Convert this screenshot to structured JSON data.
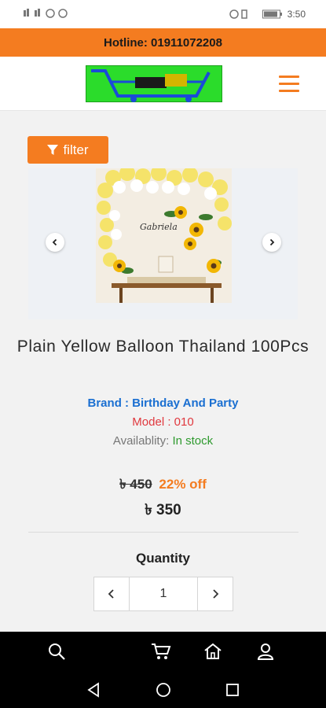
{
  "status_bar": {
    "time": "3:50",
    "battery": "88"
  },
  "hotline": "Hotline: 01911072208",
  "logo_icon": "shopping-cart-logo",
  "filter": {
    "label": "filter",
    "icon": "funnel-icon"
  },
  "carousel": {
    "prev_icon": "chevron-left-icon",
    "next_icon": "chevron-right-icon",
    "image_caption": "Gabriela"
  },
  "product": {
    "title": "Plain Yellow Balloon Thailand 100Pcs",
    "brand": "Brand : Birthday And Party",
    "model": "Model : 010",
    "availability_label": "Availablity:",
    "availability_value": "In stock",
    "old_price": "৳ 450",
    "discount": "22% off",
    "price": "৳ 350"
  },
  "quantity": {
    "label": "Quantity",
    "value": "1"
  },
  "colors": {
    "accent": "#f47c20",
    "brand_blue": "#1a6fd1",
    "model_red": "#e0383e",
    "stock_green": "#2f9a2f"
  },
  "bottom_nav": [
    "search-icon",
    "cart-icon",
    "home-icon",
    "user-icon"
  ],
  "system_nav": [
    "back-icon",
    "home-circle-icon",
    "recents-icon"
  ]
}
